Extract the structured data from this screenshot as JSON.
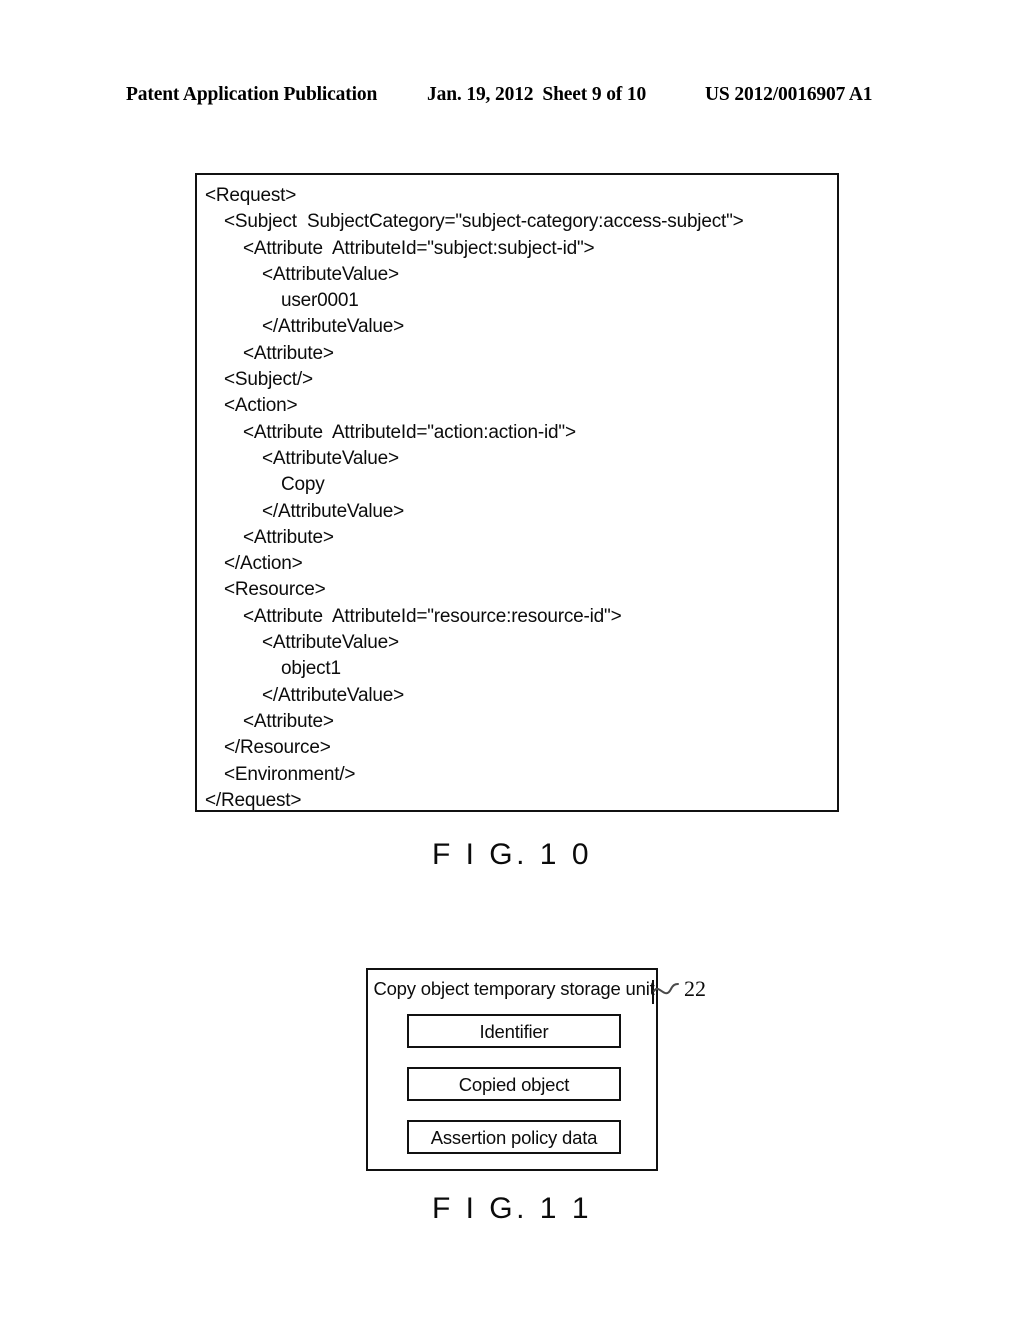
{
  "header": {
    "left": "Patent Application Publication",
    "date": "Jan. 19, 2012",
    "sheet": "Sheet 9 of 10",
    "publication_number": "US 2012/0016907 A1"
  },
  "fig10": {
    "caption": "F I G. 1 0",
    "code_lines": [
      {
        "indent": 0,
        "text": "<Request>"
      },
      {
        "indent": 1,
        "text": "<Subject  SubjectCategory=\"subject-category:access-subject\">"
      },
      {
        "indent": 2,
        "text": "<Attribute  AttributeId=\"subject:subject-id\">"
      },
      {
        "indent": 3,
        "text": "<AttributeValue>"
      },
      {
        "indent": 4,
        "text": "user0001"
      },
      {
        "indent": 3,
        "text": "</AttributeValue>"
      },
      {
        "indent": 2,
        "text": "<Attribute>"
      },
      {
        "indent": 1,
        "text": "<Subject/>"
      },
      {
        "indent": 1,
        "text": "<Action>"
      },
      {
        "indent": 2,
        "text": "<Attribute  AttributeId=\"action:action-id\">"
      },
      {
        "indent": 3,
        "text": "<AttributeValue>"
      },
      {
        "indent": 4,
        "text": "Copy"
      },
      {
        "indent": 3,
        "text": "</AttributeValue>"
      },
      {
        "indent": 2,
        "text": "<Attribute>"
      },
      {
        "indent": 1,
        "text": "</Action>"
      },
      {
        "indent": 1,
        "text": "<Resource>"
      },
      {
        "indent": 2,
        "text": "<Attribute  AttributeId=\"resource:resource-id\">"
      },
      {
        "indent": 3,
        "text": "<AttributeValue>"
      },
      {
        "indent": 4,
        "text": "object1"
      },
      {
        "indent": 3,
        "text": "</AttributeValue>"
      },
      {
        "indent": 2,
        "text": "<Attribute>"
      },
      {
        "indent": 1,
        "text": "</Resource>"
      },
      {
        "indent": 1,
        "text": "<Environment/>"
      },
      {
        "indent": 0,
        "text": "</Request>"
      }
    ]
  },
  "fig11": {
    "caption": "F I G. 1 1",
    "outer_box_label": "Copy object temporary storage unit",
    "reference_numeral": "22",
    "inner_boxes": [
      {
        "label": "Identifier"
      },
      {
        "label": "Copied object"
      },
      {
        "label": "Assertion policy data"
      }
    ]
  },
  "colors": {
    "ink": "#111111",
    "paper": "#ffffff"
  }
}
